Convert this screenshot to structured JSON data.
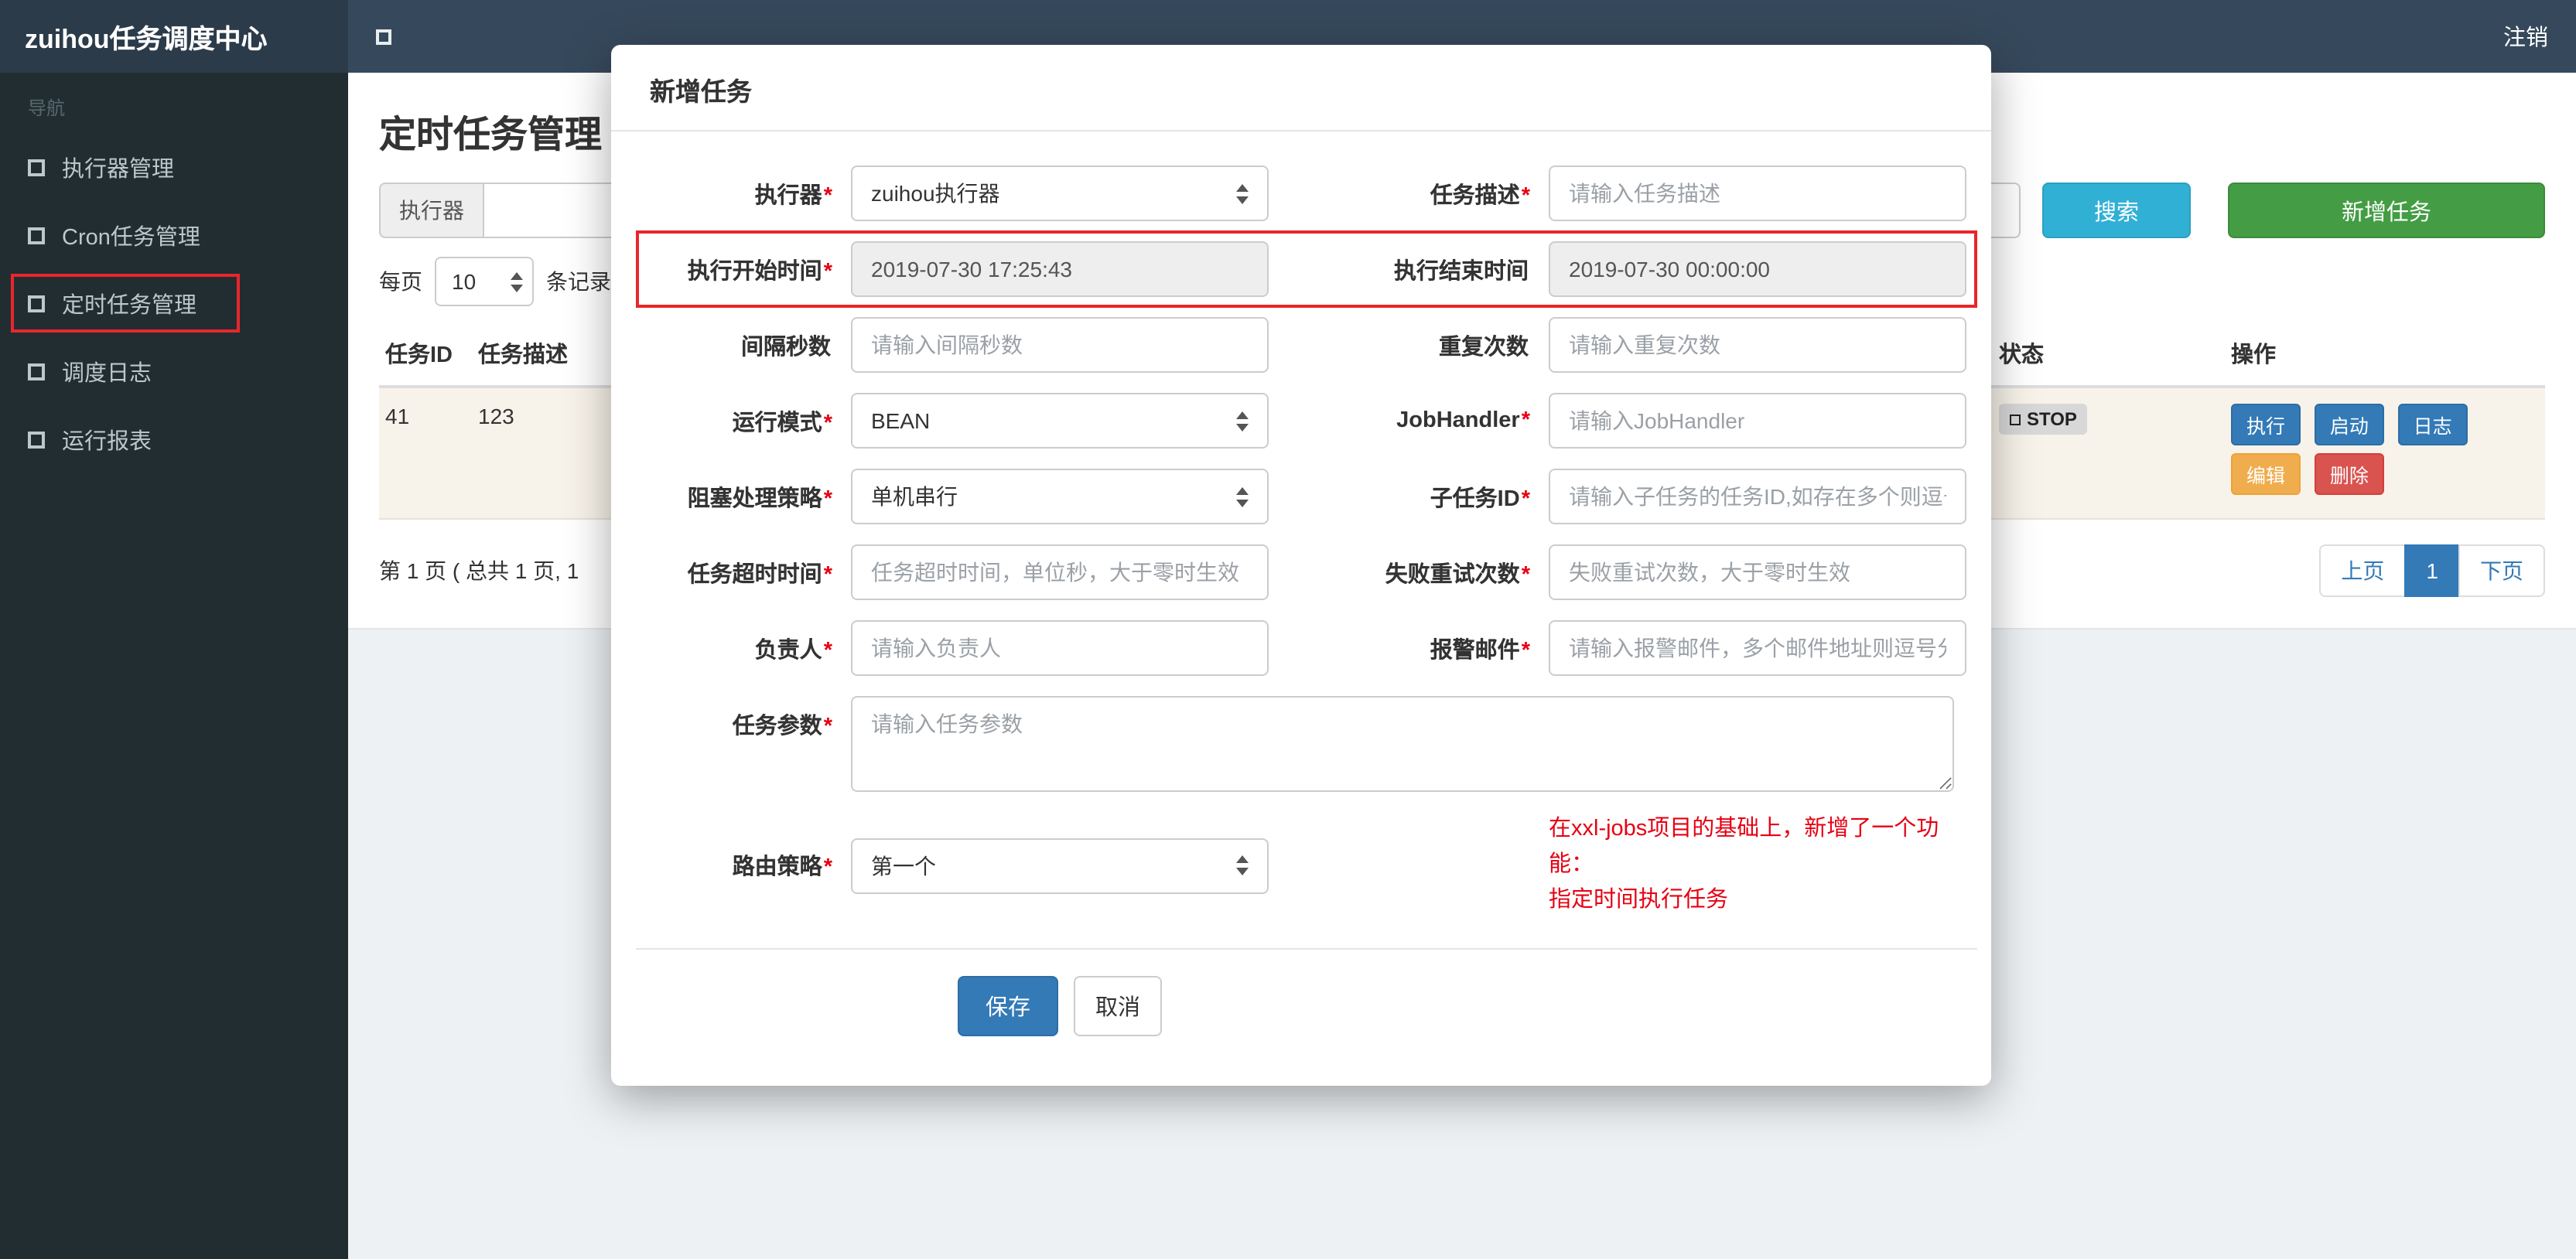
{
  "theme": {
    "navbar_bg": "#36495c",
    "brand_bg": "#2c3b4a",
    "sidebar_bg": "#222d32",
    "primary_blue": "#337ab7",
    "search_teal": "#31b0d5",
    "add_green": "#449d44",
    "warning_orange": "#f0ad4e",
    "danger_red": "#d9534f",
    "annotation_red": "#e8262b",
    "note_red": "#e60012",
    "row_highlight": "#f8f3ea"
  },
  "navbar": {
    "brand": "zuihou任务调度中心",
    "logout": "注销"
  },
  "sidebar": {
    "nav_label": "导航",
    "items": [
      {
        "label": "执行器管理",
        "color": "#d9534f"
      },
      {
        "label": "Cron任务管理",
        "color": "#f0ad4e"
      },
      {
        "label": "定时任务管理",
        "color": "#3e464c",
        "annotated": true
      },
      {
        "label": "调度日志",
        "color": "#5cb85c"
      },
      {
        "label": "运行报表",
        "color": "#31b0d5"
      }
    ]
  },
  "page": {
    "title": "定时任务管理",
    "filter": {
      "executor_label": "执行器",
      "search_button": "搜索",
      "add_button": "新增任务"
    },
    "per_page": {
      "prefix": "每页",
      "value": "10",
      "suffix": "条记录"
    },
    "table": {
      "headers": [
        "任务ID",
        "任务描述",
        "状态",
        "操作"
      ],
      "row": {
        "id": "41",
        "desc": "123",
        "status": "STOP",
        "actions_row1": [
          "执行",
          "启动",
          "日志"
        ],
        "actions_row2": [
          "编辑",
          "删除"
        ]
      }
    },
    "pagination": {
      "summary": "第 1 页 ( 总共 1 页, 1",
      "prev": "上页",
      "page": "1",
      "next": "下页"
    }
  },
  "modal": {
    "title": "新增任务",
    "fields": {
      "executor": {
        "label": "执行器",
        "required": "*",
        "value": "zuihou执行器"
      },
      "job_desc": {
        "label": "任务描述",
        "required": "*",
        "placeholder": "请输入任务描述"
      },
      "start_time": {
        "label": "执行开始时间",
        "required": "*",
        "value": "2019-07-30 17:25:43"
      },
      "end_time": {
        "label": "执行结束时间",
        "required": "",
        "value": "2019-07-30 00:00:00"
      },
      "interval": {
        "label": "间隔秒数",
        "required": "",
        "placeholder": "请输入间隔秒数"
      },
      "repeat_count": {
        "label": "重复次数",
        "required": "",
        "placeholder": "请输入重复次数"
      },
      "glue_type": {
        "label": "运行模式",
        "required": "*",
        "value": "BEAN"
      },
      "job_handler": {
        "label": "JobHandler",
        "required": "*",
        "placeholder": "请输入JobHandler"
      },
      "block_strategy": {
        "label": "阻塞处理策略",
        "required": "*",
        "value": "单机串行"
      },
      "child_job": {
        "label": "子任务ID",
        "required": "*",
        "placeholder": "请输入子任务的任务ID,如存在多个则逗号分隔"
      },
      "timeout": {
        "label": "任务超时时间",
        "required": "*",
        "placeholder": "任务超时时间，单位秒，大于零时生效"
      },
      "fail_retry": {
        "label": "失败重试次数",
        "required": "*",
        "placeholder": "失败重试次数，大于零时生效"
      },
      "owner": {
        "label": "负责人",
        "required": "*",
        "placeholder": "请输入负责人"
      },
      "alarm_email": {
        "label": "报警邮件",
        "required": "*",
        "placeholder": "请输入报警邮件，多个邮件地址则逗号分隔"
      },
      "job_param": {
        "label": "任务参数",
        "required": "*",
        "placeholder": "请输入任务参数"
      },
      "route_strategy": {
        "label": "路由策略",
        "required": "*",
        "value": "第一个"
      }
    },
    "note": {
      "line1": "在xxl-jobs项目的基础上，新增了一个功能：",
      "line2": "指定时间执行任务"
    },
    "save": "保存",
    "cancel": "取消"
  }
}
